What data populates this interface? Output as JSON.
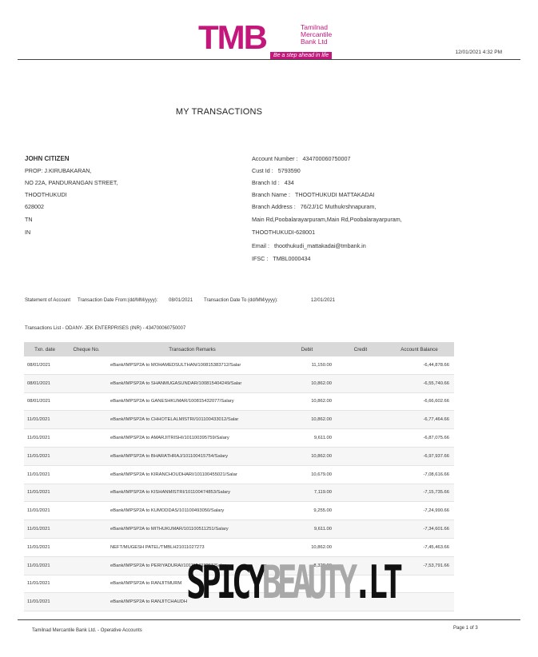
{
  "bank": {
    "logo_text": "TMB",
    "name_lines": [
      "Tamilnad",
      "Mercantile",
      "Bank Ltd"
    ],
    "tagline": "Be a step ahead in life"
  },
  "printed_at": "12/01/2021 4:32 PM",
  "page_title": "MY TRANSACTIONS",
  "customer": {
    "name": "JOHN CITIZEN",
    "lines": [
      "PROP: J.KIRUBAKARAN,",
      "NO 22A, PANDURANGAN STREET,",
      "THOOTHUKUDI",
      "628002",
      "TN",
      "IN"
    ]
  },
  "account": {
    "fields": [
      {
        "label": "Account Number :",
        "value": "434700060750007"
      },
      {
        "label": "Cust Id :",
        "value": "5793590"
      },
      {
        "label": "Branch Id :",
        "value": "434"
      },
      {
        "label": "Branch Name :",
        "value": "THOOTHUKUDI MATTAKADAI"
      },
      {
        "label": "Branch Address :",
        "value": "76/2J/1C Muthukrshnapuram,"
      },
      {
        "label": "",
        "value": "Main Rd,Poobalarayarpuram,Main Rd,Poobalarayarpuram,"
      },
      {
        "label": "",
        "value": "THOOTHUKUDI-628001"
      },
      {
        "label": "Email :",
        "value": "thoothukudi_mattakadai@tmbank.in"
      },
      {
        "label": "IFSC :",
        "value": "TMBL0000434"
      }
    ]
  },
  "statement": {
    "label": "Statement of Account",
    "from_label": "Transaction Date From:(dd/MM/yyyy):",
    "from_value": "08/01/2021",
    "to_label": "Transaction Date To (dd/MM/yyyy):",
    "to_value": "12/01/2021"
  },
  "transactions_list_label": "Transactions List - ODANY- JEK ENTERPRISES (INR) - 434700060750007",
  "table": {
    "headers": [
      "Txn. date",
      "Cheque No.",
      "Transaction Remarks",
      "Debit",
      "Credit",
      "Account Balance"
    ],
    "rows": [
      [
        "08/01/2021",
        "",
        "eBank/IMPSP2A to MOHAMEDSULTHAN/100815383712/Salar",
        "11,150.00",
        "",
        "-6,44,878.66"
      ],
      [
        "08/01/2021",
        "",
        "eBank/IMPSP2A to SHANMUGASUNDAR/100815404249/Salar",
        "10,862.00",
        "",
        "-6,55,740.66"
      ],
      [
        "08/01/2021",
        "",
        "eBank/IMPSP2A to GANESHKUMAR/100815432077/Salary",
        "10,862.00",
        "",
        "-6,66,602.66"
      ],
      [
        "11/01/2021",
        "",
        "eBank/IMPSP2A to CHHOTELALMISTRI/101100433012/Salar",
        "10,862.00",
        "",
        "-6,77,464.66"
      ],
      [
        "11/01/2021",
        "",
        "eBank/IMPSP2A to AMARJITRISHI/101100395759/Salary",
        "9,611.00",
        "",
        "-6,87,075.66"
      ],
      [
        "11/01/2021",
        "",
        "eBank/IMPSP2A to BHARATHRAJ/101100415754/Salary",
        "10,862.00",
        "",
        "-6,97,937.66"
      ],
      [
        "11/01/2021",
        "",
        "eBank/IMPSP2A to KIRANCHOUDHARI/101100455021/Salar",
        "10,679.00",
        "",
        "-7,08,616.66"
      ],
      [
        "11/01/2021",
        "",
        "eBank/IMPSP2A to KISHANMISTRI/101100474853/Salary",
        "7,119.00",
        "",
        "-7,15,735.66"
      ],
      [
        "11/01/2021",
        "",
        "eBank/IMPSP2A to KUMODDAS/101100493050/Salary",
        "9,255.00",
        "",
        "-7,24,990.66"
      ],
      [
        "11/01/2021",
        "",
        "eBank/IMPSP2A to MITHUKUMAR/101100511251/Salary",
        "9,611.00",
        "",
        "-7,34,601.66"
      ],
      [
        "11/01/2021",
        "",
        "NEFT/MUGESH PATEL/TMBLH21011027273",
        "10,862.00",
        "",
        "-7,45,463.66"
      ],
      [
        "11/01/2021",
        "",
        "eBank/IMPSP2A to PERIYADURAI/101115493253/Salary",
        "8,328.00",
        "",
        "-7,53,791.66"
      ],
      [
        "11/01/2021",
        "",
        "eBank/IMPSP2A to RANJITMURM",
        "",
        "",
        ""
      ],
      [
        "11/01/2021",
        "",
        "eBank/IMPSP2A to RANJITCHAUDH",
        "",
        "",
        ""
      ]
    ]
  },
  "footer": {
    "left": "Tamilnad Mercantile Bank Ltd. - Operative Accounts",
    "right": "Page 1 of 3"
  },
  "watermark": {
    "part1": "SPICY",
    "part2": "BEAUTY",
    "part3": ".LT"
  },
  "colors": {
    "brand_magenta": "#c4177c",
    "brand_blue": "#1f2f86"
  }
}
